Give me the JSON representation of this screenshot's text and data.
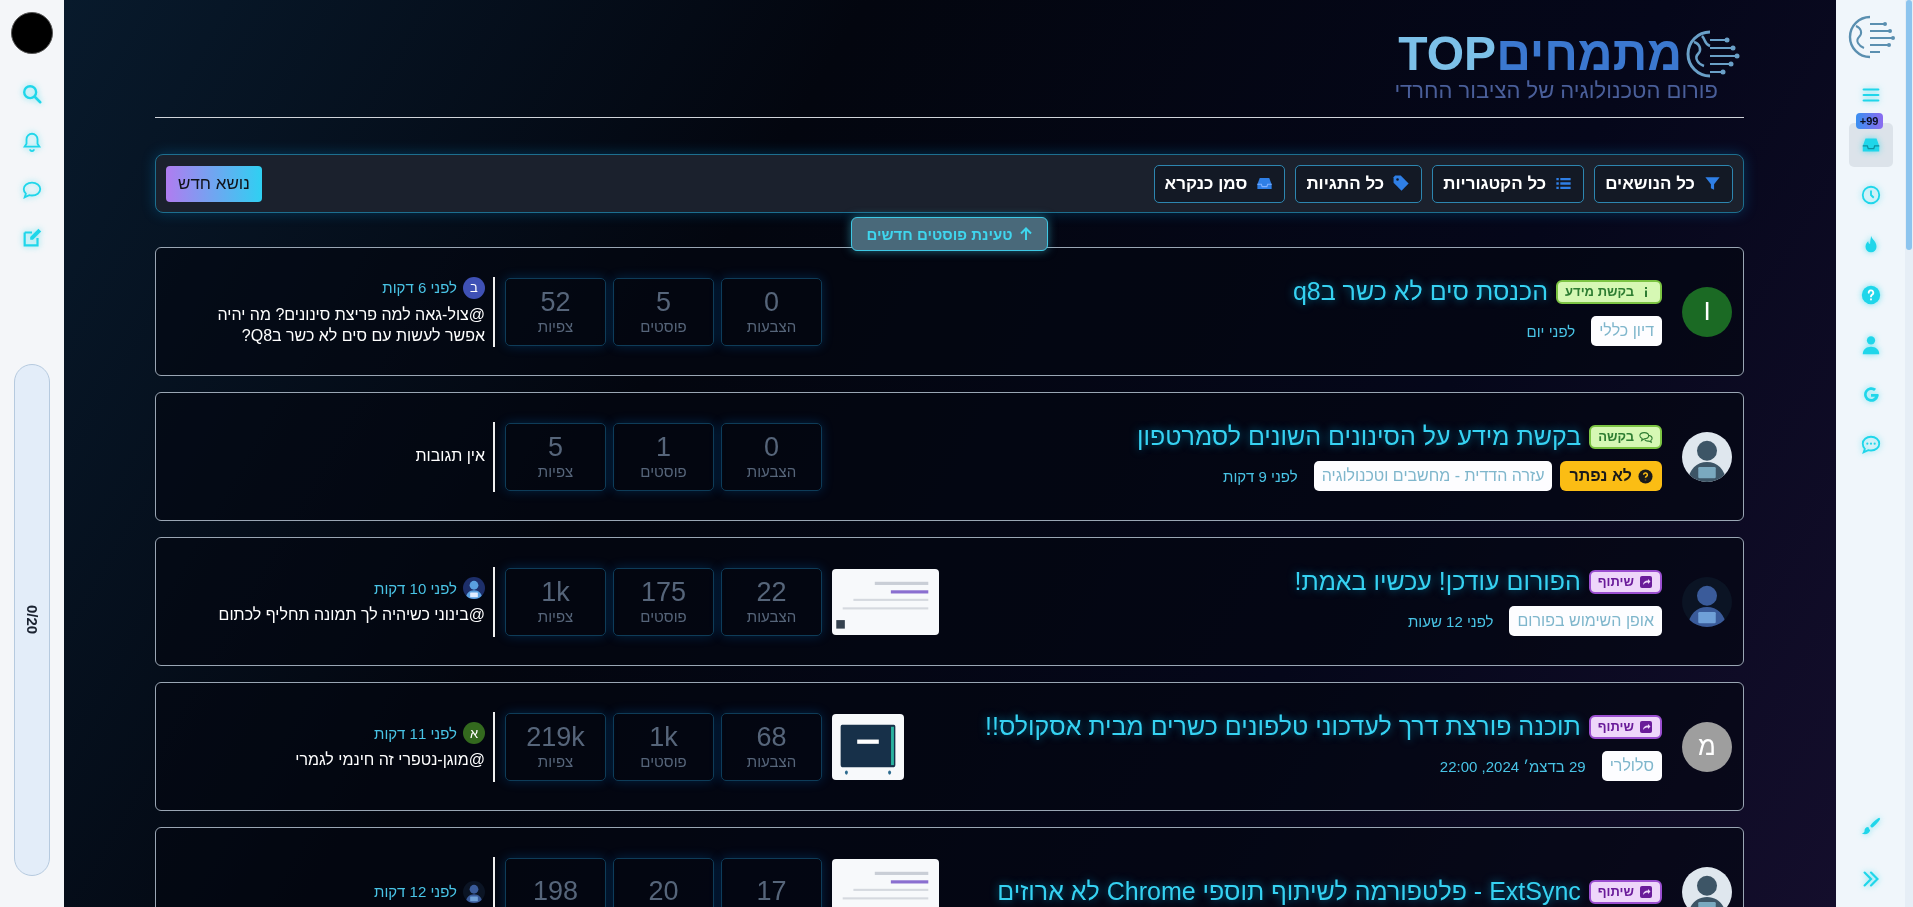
{
  "left_sidebar": {
    "progress": "0/20",
    "level": 0
  },
  "header": {
    "logo_hebrew": "מתמחים",
    "logo_latin": "TOP",
    "tagline": "פורום הטכנולוגיה של הציבור החרדי"
  },
  "toolbar": {
    "filters": [
      {
        "kind": "filter",
        "label": "כל הנושאים"
      },
      {
        "kind": "list",
        "label": "כל הקטגוריות"
      },
      {
        "kind": "tag",
        "label": "כל התגיות"
      },
      {
        "kind": "inbox",
        "label": "סמן כנקרא"
      }
    ],
    "new_topic": "נושא חדש"
  },
  "load_new": "טעינת פוסטים חדשים",
  "topics": [
    {
      "avatar": {
        "kind": "letter",
        "letter": "I",
        "color": "#1b6a24"
      },
      "badge": {
        "kind": "info",
        "label": "בקשת מידע"
      },
      "title": "הכנסת סים לא כשר בq8",
      "tags": [
        "דיון כללי"
      ],
      "time": "לפני יום",
      "stats": [
        {
          "value": "0",
          "label": "הצבעות"
        },
        {
          "value": "5",
          "label": "פוסטים"
        },
        {
          "value": "52",
          "label": "צפיות"
        }
      ],
      "last_post": {
        "avatar": {
          "kind": "letter",
          "letter": "ב",
          "color": "#3f51b5"
        },
        "time": "לפני 6 דקות",
        "text": "@צול-גאה למה פריצת סינונים? מה יהיה אפשר לעשות עם סים לא כשר בQ8?"
      }
    },
    {
      "avatar": {
        "kind": "picture"
      },
      "badge": {
        "kind": "request",
        "label": "בקשה"
      },
      "title": "בקשת מידע על הסינונים השונים לסמרטפון",
      "status": "לא נפתר",
      "tags": [
        "עזרה הדדית - מחשבים וטכנולוגיה"
      ],
      "time": "לפני 9 דקות",
      "stats": [
        {
          "value": "0",
          "label": "הצבעות"
        },
        {
          "value": "1",
          "label": "פוסטים"
        },
        {
          "value": "5",
          "label": "צפיות"
        }
      ],
      "last_post": {
        "text": "אין תגובות"
      }
    },
    {
      "avatar": {
        "kind": "picture"
      },
      "badge": {
        "kind": "share",
        "label": "שיתוף"
      },
      "title": "הפורום עודכן! עכשיו באמת!",
      "tags": [
        "אופן השימוש בפורום"
      ],
      "time": "לפני 12 שעות",
      "thumbnail": {
        "kind": "picture"
      },
      "stats": [
        {
          "value": "22",
          "label": "הצבעות"
        },
        {
          "value": "175",
          "label": "פוסטים"
        },
        {
          "value": "1k",
          "label": "צפיות"
        }
      ],
      "last_post": {
        "avatar": {
          "kind": "picture"
        },
        "time": "לפני 10 דקות",
        "text": "@בינוני כשיהיה לך תמונה תחליף לכתום"
      }
    },
    {
      "avatar": {
        "kind": "letter",
        "letter": "מ",
        "color": "#9e9e9e"
      },
      "badge": {
        "kind": "share",
        "label": "שיתוף"
      },
      "title": "תוכנה פורצת דרך לעדכוני טלפונים כשרים מבית אסקולס!!",
      "tags": [
        "סלולרי"
      ],
      "time": "29 בדצמ׳ 2024, 22:00",
      "thumbnail": {
        "kind": "picture"
      },
      "stats": [
        {
          "value": "68",
          "label": "הצבעות"
        },
        {
          "value": "1k",
          "label": "פוסטים"
        },
        {
          "value": "219k",
          "label": "צפיות"
        }
      ],
      "last_post": {
        "avatar": {
          "kind": "letter",
          "letter": "א",
          "color": "#33691e"
        },
        "time": "לפני 11 דקות",
        "text": "@מוגן-נטפרי זה חינמי לגמרי"
      }
    },
    {
      "avatar": {
        "kind": "picture"
      },
      "badge": {
        "kind": "share",
        "label": "שיתוף"
      },
      "title": "ExtSync - פלטפורמה לשיתוף תוספי Chrome לא ארוזים",
      "thumbnail": {
        "kind": "picture"
      },
      "stats": [
        {
          "value": "17"
        },
        {
          "value": "20"
        },
        {
          "value": "198"
        }
      ],
      "last_post": {
        "avatar": {
          "kind": "picture"
        },
        "time": "לפני 12 דקות"
      }
    }
  ],
  "right_sidebar": {
    "nav": [
      {
        "kind": "menu",
        "selected": false
      },
      {
        "kind": "inbox",
        "selected": true,
        "badge": "+99"
      },
      {
        "kind": "clock",
        "selected": false
      },
      {
        "kind": "fire",
        "selected": false
      },
      {
        "kind": "help",
        "selected": false
      },
      {
        "kind": "user",
        "selected": false
      },
      {
        "kind": "google",
        "selected": false
      },
      {
        "kind": "chat",
        "selected": false
      }
    ],
    "bottom": [
      {
        "kind": "brush",
        "selected": false
      },
      {
        "kind": "expand",
        "selected": false
      }
    ]
  }
}
